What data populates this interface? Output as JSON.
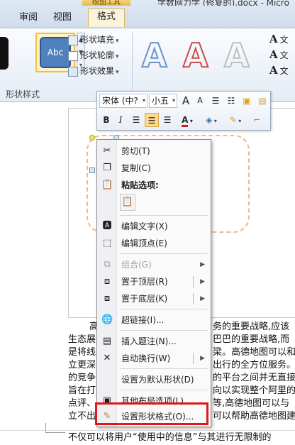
{
  "ribbon": {
    "context_group": "绘图工具",
    "doc_title": "学数网力学 (修复的).docx - Micro",
    "tabs": [
      "审阅",
      "视图",
      "格式"
    ],
    "active_tab": "格式",
    "shape_style_sample": "Abc",
    "shape_commands": [
      "形状填充",
      "形状轮廓",
      "形状效果"
    ],
    "group_label": "形状样式",
    "text_commands": [
      "文",
      "文",
      "文"
    ],
    "wordart_letters": [
      "A",
      "A",
      "A"
    ],
    "colors": {
      "active_tab": "#fbf4dd",
      "shape_fill": "#4f81bd",
      "highlight": "#e0161b"
    }
  },
  "mini_toolbar": {
    "font_name": "宋体 (中?",
    "font_size": "小五",
    "grow_font": "A",
    "shrink_font": "A",
    "bold": "B",
    "italic": "I",
    "font_color_label": "A"
  },
  "context_menu": {
    "items": [
      {
        "label": "剪切(T)",
        "icon": "scissors-icon",
        "enabled": true
      },
      {
        "label": "复制(C)",
        "icon": "copy-icon",
        "enabled": true
      },
      {
        "label": "粘贴选项:",
        "icon": "paste-icon",
        "enabled": true,
        "header": true
      },
      {
        "label": "编辑文字(X)",
        "icon": "edit-text-icon",
        "enabled": true
      },
      {
        "label": "编辑顶点(E)",
        "icon": "edit-points-icon",
        "enabled": true
      },
      {
        "label": "组合(G)",
        "icon": "group-icon",
        "enabled": false,
        "submenu": true
      },
      {
        "label": "置于顶层(R)",
        "icon": "bring-front-icon",
        "enabled": true,
        "submenu": true
      },
      {
        "label": "置于底层(K)",
        "icon": "send-back-icon",
        "enabled": true,
        "submenu": true
      },
      {
        "label": "超链接(I)...",
        "icon": "hyperlink-icon",
        "enabled": true
      },
      {
        "label": "插入题注(N)...",
        "icon": "caption-icon",
        "enabled": true
      },
      {
        "label": "自动换行(W)",
        "icon": "wrap-text-icon",
        "enabled": true,
        "submenu": true
      },
      {
        "label": "设置为默认形状(D)",
        "icon": "",
        "enabled": true
      },
      {
        "label": "其他布局选项(L)...",
        "icon": "layout-icon",
        "enabled": true
      },
      {
        "label": "设置形状格式(O)...",
        "icon": "format-shape-icon",
        "enabled": true
      }
    ]
  },
  "document": {
    "lines": [
      {
        "left": "高",
        "right": "务的重要战略,应该"
      },
      {
        "left": "生态展",
        "right": "巴巴的重要战略,而"
      },
      {
        "left": "是将线",
        "right": "梁。高德地图可以和"
      },
      {
        "left": "立更深",
        "right": "出行的全方位服务。"
      },
      {
        "left": "的竞争",
        "right": "的平台之间并无直接"
      },
      {
        "left": "旨在打",
        "right": "向以实现整个阿里的"
      },
      {
        "left": "点评、",
        "right": "等,高德地图可以与"
      },
      {
        "left": "立不出",
        "right": "可以帮助高德地图建"
      }
    ],
    "last_line": "不仅可以将用户“使用中的信息”与其进行无限制的"
  }
}
